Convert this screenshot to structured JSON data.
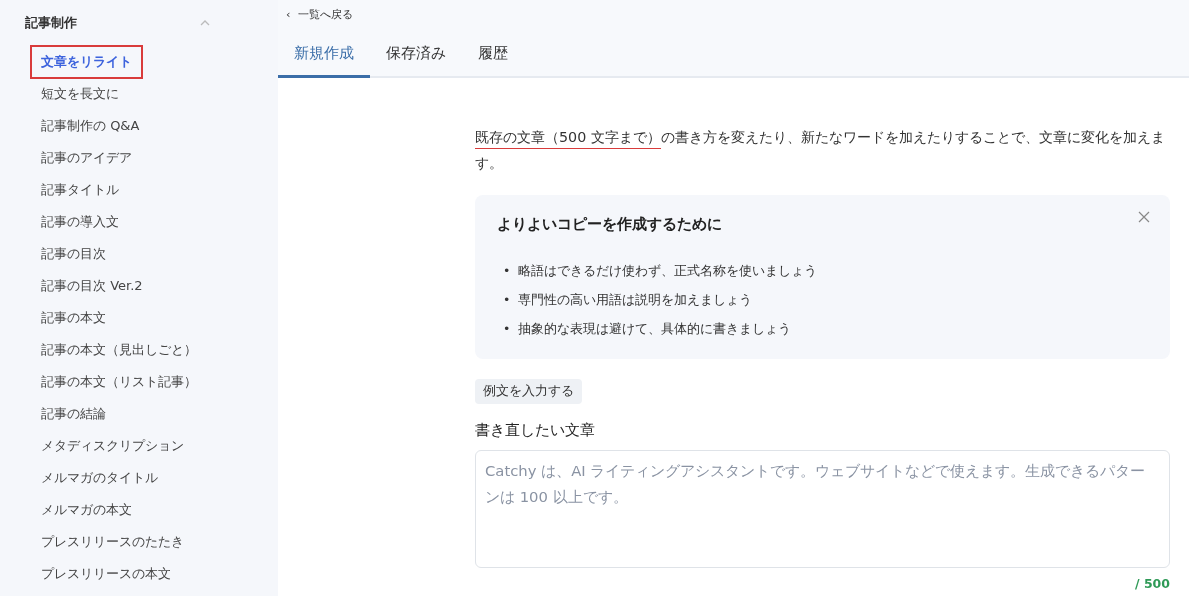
{
  "sidebar": {
    "section": {
      "title": "記事制作",
      "expanded": true
    },
    "items": [
      {
        "label": "文章をリライト",
        "selected": true,
        "highlighted": true
      },
      {
        "label": "短文を長文に",
        "selected": false,
        "highlighted": false
      },
      {
        "label": "記事制作の Q&A",
        "selected": false,
        "highlighted": false
      },
      {
        "label": "記事のアイデア",
        "selected": false,
        "highlighted": false
      },
      {
        "label": "記事タイトル",
        "selected": false,
        "highlighted": false
      },
      {
        "label": "記事の導入文",
        "selected": false,
        "highlighted": false
      },
      {
        "label": "記事の目次",
        "selected": false,
        "highlighted": false
      },
      {
        "label": "記事の目次 Ver.2",
        "selected": false,
        "highlighted": false
      },
      {
        "label": "記事の本文",
        "selected": false,
        "highlighted": false
      },
      {
        "label": "記事の本文（見出しごと）",
        "selected": false,
        "highlighted": false
      },
      {
        "label": "記事の本文（リスト記事）",
        "selected": false,
        "highlighted": false
      },
      {
        "label": "記事の結論",
        "selected": false,
        "highlighted": false
      },
      {
        "label": "メタディスクリプション",
        "selected": false,
        "highlighted": false
      },
      {
        "label": "メルマガのタイトル",
        "selected": false,
        "highlighted": false
      },
      {
        "label": "メルマガの本文",
        "selected": false,
        "highlighted": false
      },
      {
        "label": "プレスリリースのたたき",
        "selected": false,
        "highlighted": false
      },
      {
        "label": "プレスリリースの本文",
        "selected": false,
        "highlighted": false
      }
    ]
  },
  "back_link": {
    "icon": "‹",
    "label": "一覧へ戻る"
  },
  "tabs": [
    {
      "label": "新規作成",
      "selected": true
    },
    {
      "label": "保存済み",
      "selected": false
    },
    {
      "label": "履歴",
      "selected": false
    }
  ],
  "description": [
    {
      "text": "既存の文章（500 文字まで）",
      "underlined": true
    },
    {
      "text": "の書き方を変えたり、新たなワードを加えたりすることで、文章に変化を加えます。",
      "underlined": false
    }
  ],
  "tips": {
    "title": "よりよいコピーを作成するために",
    "items": [
      {
        "bullet": "•",
        "text": "略語はできるだけ使わず、正式名称を使いましょう"
      },
      {
        "bullet": "•",
        "text": "専門性の高い用語は説明を加えましょう"
      },
      {
        "bullet": "•",
        "text": "抽象的な表現は避けて、具体的に書きましょう"
      }
    ]
  },
  "example_button": "例文を入力する",
  "input": {
    "label": "書き直したい文章",
    "placeholder": "Catchy は、AI ライティングアシスタントです。ウェブサイトなどで使えます。生成できるパターンは 100 以上です。"
  },
  "counter": "/ 500"
}
